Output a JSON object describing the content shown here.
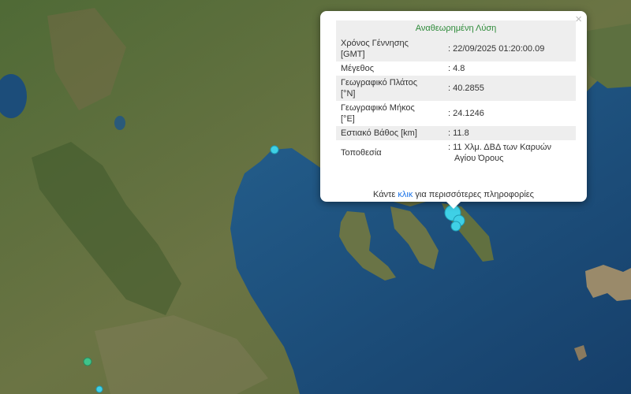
{
  "popup": {
    "title": "Αναθεωρημένη Λύση",
    "close_icon": "×",
    "rows": [
      {
        "label_l1": "Χρόνος Γέννησης",
        "label_l2": "[GMT]",
        "value_l1": ": 22/09/2025 01:20:00.09",
        "value_l2": ""
      },
      {
        "label_l1": "Μέγεθος",
        "label_l2": "",
        "value_l1": ": 4.8",
        "value_l2": ""
      },
      {
        "label_l1": "Γεωγραφικό Πλάτος",
        "label_l2": "[°N]",
        "value_l1": ": 40.2855",
        "value_l2": ""
      },
      {
        "label_l1": "Γεωγραφικό Μήκος",
        "label_l2": "[°E]",
        "value_l1": ": 24.1246",
        "value_l2": ""
      },
      {
        "label_l1": "Εστιακό Βάθος [km]",
        "label_l2": "",
        "value_l1": ": 11.8",
        "value_l2": ""
      },
      {
        "label_l1": "Τοποθεσία",
        "label_l2": "",
        "value_l1": ": 11 Χλμ. ΔΒΔ των Καρυών",
        "value_l2": "Αγίου Όρους"
      }
    ],
    "more_prefix": "Κάντε ",
    "more_link": "κλικ",
    "more_suffix": " για περισσότερες πληροφορίες"
  },
  "colors": {
    "sea": "#1f5a8a",
    "land": "#5a6b3e",
    "marker": "#3fd0e6",
    "marker_small": "#3fc38a",
    "title_text": "#2e8b3a",
    "link": "#1a73e8"
  }
}
